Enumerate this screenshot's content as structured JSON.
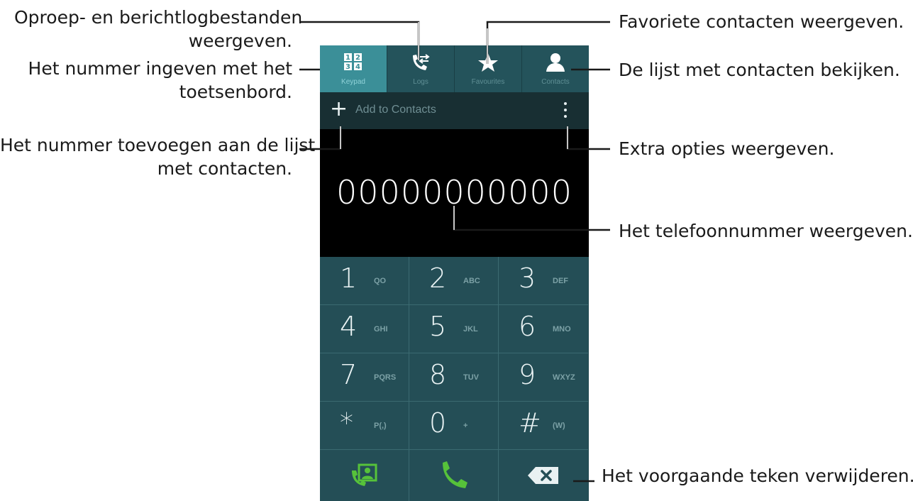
{
  "callouts": {
    "logs": [
      "Oproep- en berichtlogbestanden",
      "weergeven."
    ],
    "keypad": [
      "Het nummer ingeven met het",
      "toetsenbord."
    ],
    "add_contact": [
      "Het nummer toevoegen aan de lijst",
      "met contacten."
    ],
    "favourites": "Favoriete contacten weergeven.",
    "contacts": "De lijst met contacten bekijken.",
    "more_options": "Extra opties weergeven.",
    "phone_number": "Het telefoonnummer weergeven.",
    "backspace": "Het voorgaande teken verwijderen."
  },
  "tabs": [
    {
      "label": "Keypad",
      "icon": "keypad-icon",
      "active": true
    },
    {
      "label": "Logs",
      "icon": "logs-icon",
      "active": false
    },
    {
      "label": "Favourites",
      "icon": "star-icon",
      "active": false
    },
    {
      "label": "Contacts",
      "icon": "contacts-icon",
      "active": false
    }
  ],
  "action_bar": {
    "add_icon": "plus-icon",
    "add_label": "Add to Contacts",
    "more_icon": "more-options-icon"
  },
  "display": {
    "number": "00000000000"
  },
  "keys": [
    {
      "digit": "1",
      "letters": "QO"
    },
    {
      "digit": "2",
      "letters": "ABC"
    },
    {
      "digit": "3",
      "letters": "DEF"
    },
    {
      "digit": "4",
      "letters": "GHI"
    },
    {
      "digit": "5",
      "letters": "JKL"
    },
    {
      "digit": "6",
      "letters": "MNO"
    },
    {
      "digit": "7",
      "letters": "PQRS"
    },
    {
      "digit": "8",
      "letters": "TUV"
    },
    {
      "digit": "9",
      "letters": "WXYZ"
    },
    {
      "digit": "*",
      "letters": "P(,)"
    },
    {
      "digit": "0",
      "letters": "+"
    },
    {
      "digit": "#",
      "letters": "(W)"
    }
  ],
  "bottom_row": {
    "left_icon": "contact-card-icon",
    "middle_icon": "call-icon",
    "right_icon": "backspace-icon"
  },
  "colors": {
    "tab_active": "#3b8f98",
    "keypad_bg": "#244e56",
    "call_green": "#56c23a"
  }
}
